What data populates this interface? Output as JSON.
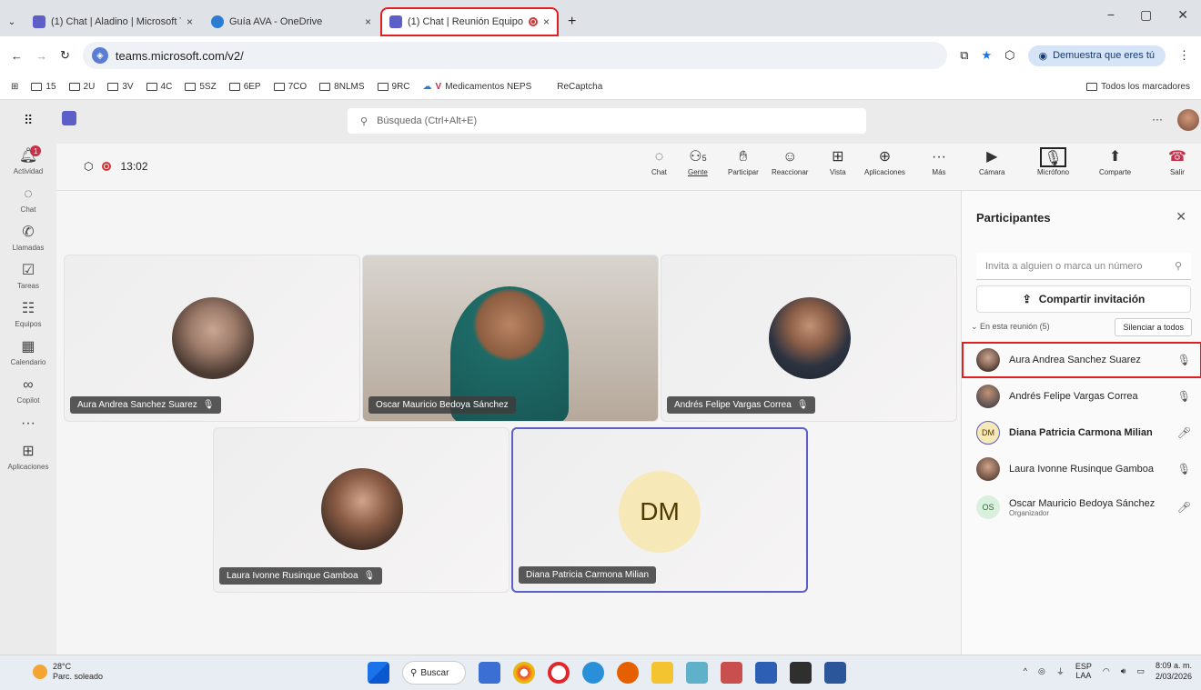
{
  "browser": {
    "tabs": [
      {
        "title": "(1) Chat | Aladino | Microsoft Te",
        "close": "×"
      },
      {
        "title": "Guía AVA - OneDrive",
        "close": "×"
      },
      {
        "title": "(1) Chat | Reunión Equipo (",
        "close": "×"
      }
    ],
    "new_tab": "+",
    "url": "teams.microsoft.com/v2/",
    "profile_button": "Demuestra que eres tú",
    "bookmarks": [
      "15",
      "2U",
      "3V",
      "4C",
      "5SZ",
      "6EP",
      "7CO",
      "8NLMS",
      "9RC"
    ],
    "bookmark_special": "Medicamentos NEPS",
    "bookmark_recaptcha": "ReCaptcha",
    "bookmark_all": "Todos los marcadores"
  },
  "teams": {
    "search_placeholder": "Búsqueda (Ctrl+Alt+E)",
    "more": "···",
    "rail": [
      {
        "label": "Actividad",
        "icon": "bell-icon",
        "badge": "1"
      },
      {
        "label": "Chat",
        "icon": "chat-icon"
      },
      {
        "label": "Llamadas",
        "icon": "phone-icon"
      },
      {
        "label": "Tareas",
        "icon": "tasks-icon"
      },
      {
        "label": "Equipos",
        "icon": "teams-icon"
      },
      {
        "label": "Calendario",
        "icon": "calendar-icon"
      },
      {
        "label": "Copilot",
        "icon": "copilot-icon"
      },
      {
        "label": "···",
        "icon": "more-icon"
      },
      {
        "label": "Aplicaciones",
        "icon": "apps-icon"
      }
    ],
    "meeting": {
      "timer": "13:02",
      "controls": [
        {
          "label": "Chat"
        },
        {
          "label": "Gente",
          "count": "5"
        },
        {
          "label": "Participar"
        },
        {
          "label": "Reaccionar"
        },
        {
          "label": "Vista"
        },
        {
          "label": "Aplicaciones"
        },
        {
          "label": "Más"
        },
        {
          "label": "Cámara"
        },
        {
          "label": "Micrófono"
        },
        {
          "label": "Comparte"
        },
        {
          "label": "Salir"
        }
      ]
    },
    "tiles": [
      {
        "name": "Aura Andrea Sanchez Suarez",
        "muted": true
      },
      {
        "name": "Oscar Mauricio Bedoya Sánchez",
        "muted": false
      },
      {
        "name": "Andrés Felipe Vargas Correa",
        "muted": true
      },
      {
        "name": "Laura Ivonne Rusinque Gamboa",
        "muted": true
      },
      {
        "name": "Diana Patricia Carmona Milian",
        "initials": "DM",
        "muted": false
      }
    ],
    "panel": {
      "title": "Participantes",
      "invite_placeholder": "Invita a alguien o marca un número",
      "share_invite": "Compartir invitación",
      "in_meeting": "En esta reunión (5)",
      "mute_all": "Silenciar a todos",
      "people": [
        {
          "name": "Aura Andrea Sanchez Suarez",
          "mic": "muted"
        },
        {
          "name": "Andrés Felipe Vargas Correa",
          "mic": "muted"
        },
        {
          "name": "Diana Patricia Carmona Milian",
          "initials": "DM",
          "mic": "on"
        },
        {
          "name": "Laura Ivonne Rusinque Gamboa",
          "mic": "muted"
        },
        {
          "name": "Oscar Mauricio Bedoya Sánchez",
          "initials": "OS",
          "role": "Organizador",
          "mic": "on"
        }
      ]
    }
  },
  "taskbar": {
    "temp": "28°C",
    "weather": "Parc. soleado",
    "search": "Buscar",
    "lang1": "ESP",
    "lang2": "LAA",
    "time": "8:09 a. m.",
    "date": "2/03/2026"
  }
}
